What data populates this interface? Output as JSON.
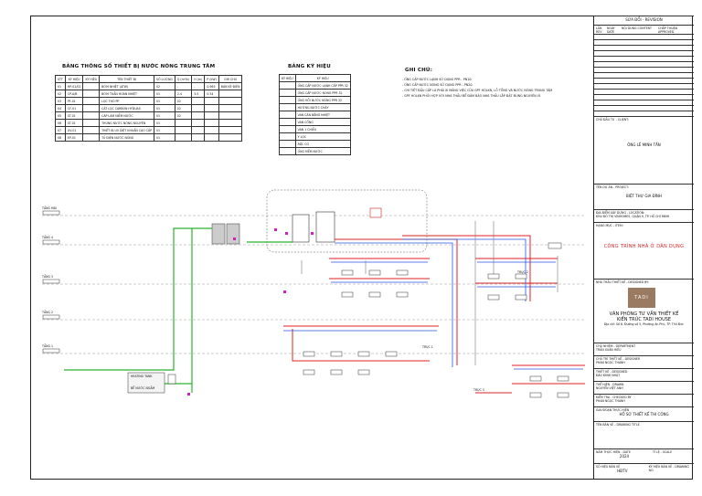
{
  "equipment_table": {
    "title": "BẢNG THÔNG SỐ THIẾT BỊ NƯỚC NÓNG TRUNG TÂM",
    "headers": [
      "STT",
      "KÝ HIỆU",
      "KÝ HIỆU",
      "TÊN THIẾT BỊ",
      "SỐ LƯỢNG",
      "Q (m³/h)",
      "H (m)",
      "P (kW)",
      "GHI CHÚ"
    ],
    "rows": [
      [
        "01",
        "HP-01/02",
        "",
        "BƠM NHIỆT (ATW)",
        "02",
        "-",
        "-",
        "0.965",
        "BÁN KÈ ĐIỆN"
      ],
      [
        "02",
        "CP-A/B",
        "",
        "BƠM TUẦN HOÀN NHIỆT",
        "01",
        "2.4",
        "5.5",
        "0.34",
        ""
      ],
      [
        "03",
        "PF-01",
        "",
        "LỌC THÔ PP",
        "01",
        "02",
        "",
        "",
        ""
      ],
      [
        "04",
        "CF-01",
        "",
        "CÁT LỌC CARBON HYDUAS",
        "01",
        "02",
        "",
        "",
        ""
      ],
      [
        "05",
        "ST-01",
        "",
        "CÁP LÀM NIỀM NƯỚC",
        "01",
        "02",
        "",
        "",
        ""
      ],
      [
        "06",
        "ST-01",
        "",
        "THÙNG NƯỚC NÓNG NGUYÊN",
        "01",
        "",
        "",
        "",
        ""
      ],
      [
        "07",
        "UV-01",
        "",
        "THIẾT BỊ UV DIỆT KHUẨN CAO CẤP",
        "01",
        "",
        "",
        "",
        ""
      ],
      [
        "08",
        "EP-01",
        "",
        "TỦ ĐIỆN NƯỚC NÓNG",
        "01",
        "",
        "",
        "",
        ""
      ]
    ]
  },
  "legend_table": {
    "title": "BẢNG KÝ HIỆU",
    "headers": [
      "KÝ HIỆU",
      "KÝ HIỆU"
    ],
    "rows": [
      [
        "",
        "ỐNG CẤP NƯỚC LẠNH CẤP PPR 32"
      ],
      [
        "",
        "ỐNG CẤP NƯỚC NÓNG PPR 32"
      ],
      [
        "",
        "ỐNG HỒI NƯỚC NÓNG PPR 32"
      ],
      [
        "",
        "HƯỚNG NƯỚC CHẢY"
      ],
      [
        "",
        "VAN CÂN BẰNG NHIỆT"
      ],
      [
        "",
        "VAN CỔNG"
      ],
      [
        "",
        "VAN 1 CHIỀU"
      ],
      [
        "",
        "Y LỌC"
      ],
      [
        "",
        "RẮC CO"
      ],
      [
        "",
        "ỐNG MỀM NƯỚC"
      ]
    ]
  },
  "notes": {
    "title": "GHI CHÚ:",
    "lines": [
      "- ỐNG CẤP NƯỚC LẠNH SỬ DỤNG PPR - PN10.",
      "- ỐNG CẤP NƯỚC NÓNG SỬ DỤNG PPR - PN20.",
      "- CHI TIẾT ĐẦU CẤP LÀ PHẢI XI MĂNG VIỆC CỦA GPF HOLKN, LỖ TỔNG VÀ NƯỚC NÓNG TRUNG TÂM",
      "- GPF HOLKN PHỐI HỢP VỚI NHÀ THẦU ĐỂ ĐẢM BẢO NHÀ THẦU LẮP ĐẶT ĐÚNG NGUYÊN LÝ."
    ]
  },
  "levels": [
    "TẦNG MÁI",
    "TẦNG 4",
    "TẦNG 3",
    "TẦNG 2",
    "TẦNG 1"
  ],
  "diagram_labels": {
    "riser1": "TRỤC 1",
    "riser2": "TRỤC 2",
    "riser3": "TRỤC 3",
    "tank": "HEATING TANK",
    "water_tank": "BỂ NƯỚC NGẦM"
  },
  "title_block": {
    "revision_title": "SỬA ĐỔI - REVISION",
    "revision_headers": [
      "LẦN REV",
      "NGÀY DATE",
      "NỘI DUNG CONTENT",
      "CHẤP THUẬN APPROVED"
    ],
    "client_label": "CHỦ ĐẦU TƯ - CLIENT:",
    "client": "ÔNG LÊ MINH TẤN",
    "project_label": "TÊN DỰ ÁN - PROJECT:",
    "project": "BIỆT THỰ GIA ĐÌNH",
    "location_label": "ĐỊA ĐIỂM XÂY DỰNG - LOCATION:",
    "location": "KHU ĐÔ THỊ VINHOMES, QUẬN 9, TP. HỒ CHÍ MINH",
    "item_label": "HẠNG MỤC - ITEM:",
    "item": "CÔNG TRÌNH NHÀ Ở DÂN DỤNG",
    "designer_label": "NHÀ THẦU THIẾT KẾ - DESIGNED BY:",
    "logo": "TADI",
    "company_line1": "VĂN PHÒNG TƯ VẤN THIẾT KẾ",
    "company_line2": "KIẾN TRÚC TADI HOUSE",
    "company_addr": "Địa chỉ: Số 8, Đường số 5, Phường An Phú, TP. Thủ Đức",
    "chief_label": "CHỦ NHIỆM - DEPARTMENT",
    "chief": "TRẦN XUÂN HIẾU",
    "design_label": "CHỦ TRÌ THIẾT KẾ - DESIGNER",
    "design": "PHAN NGỌC THANH",
    "drawn_label": "THIẾT KẾ - DESIGNED",
    "drawn": "ĐÀO ĐÌNH NHẬT",
    "check_label": "THỂ HIỆN - DRAWN",
    "check": "NGUYỄN VIỆT ANH",
    "approve_label": "KIỂM TRA - CHECKED BY",
    "approve": "PHAN NGỌC THANH",
    "stage_label": "GIAI ĐOẠN THỰC HIỆN",
    "stage": "HỒ SƠ THIẾT KẾ THI CÔNG",
    "drawing_label": "TÊN BẢN VẼ - DRAWING TITLE",
    "year_label": "NĂM THỰC HIỆN - DATE",
    "year": "2024",
    "scale_label": "TỈ LỆ - SCALE",
    "code_label": "SỐ HIỆU BẢN VẼ",
    "code": "HĐTV",
    "sheet_label": "KÝ HIỆU BẢN VẼ - DRAWING NO."
  }
}
